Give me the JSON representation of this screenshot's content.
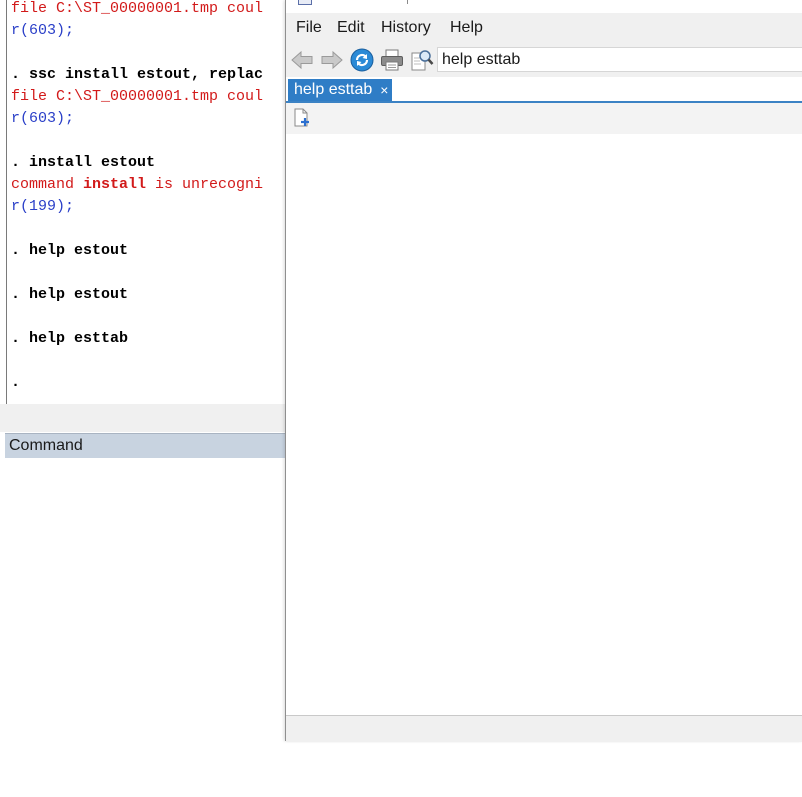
{
  "results": {
    "lines": [
      {
        "parts": [
          "file C:\\ST_00000001.tmp coul"
        ]
      },
      {
        "parts": [
          "r(603);"
        ]
      },
      {
        "parts": [
          ". ssc install estout, replac"
        ]
      },
      {
        "parts": [
          "file C:\\ST_00000001.tmp coul"
        ]
      },
      {
        "parts": [
          "r(603);"
        ]
      },
      {
        "parts": [
          ". install estout"
        ]
      },
      {
        "parts": [
          "command ",
          "install",
          " is unrecogni"
        ]
      },
      {
        "parts": [
          "r(199);"
        ]
      },
      {
        "parts": [
          ". help estout"
        ]
      },
      {
        "parts": [
          ". help estout"
        ]
      },
      {
        "parts": [
          ". help esttab"
        ]
      },
      {
        "parts": [
          "."
        ]
      }
    ]
  },
  "command_window": {
    "title": "Command"
  },
  "viewer": {
    "menu": {
      "file": "File",
      "edit": "Edit",
      "history": "History",
      "help": "Help"
    },
    "address": {
      "value": "help esttab"
    },
    "tab": {
      "label": "help esttab",
      "close": "×"
    }
  },
  "icons": {
    "back": "back-arrow-icon",
    "forward": "forward-arrow-icon",
    "refresh": "refresh-icon",
    "print": "printer-icon",
    "search": "search-icon",
    "new_viewer": "new-page-icon"
  },
  "colors": {
    "error_text": "#d21a1a",
    "return_code": "#2a3fc8",
    "tab_active": "#2f7dc6",
    "command_header": "#c8d3e0"
  }
}
